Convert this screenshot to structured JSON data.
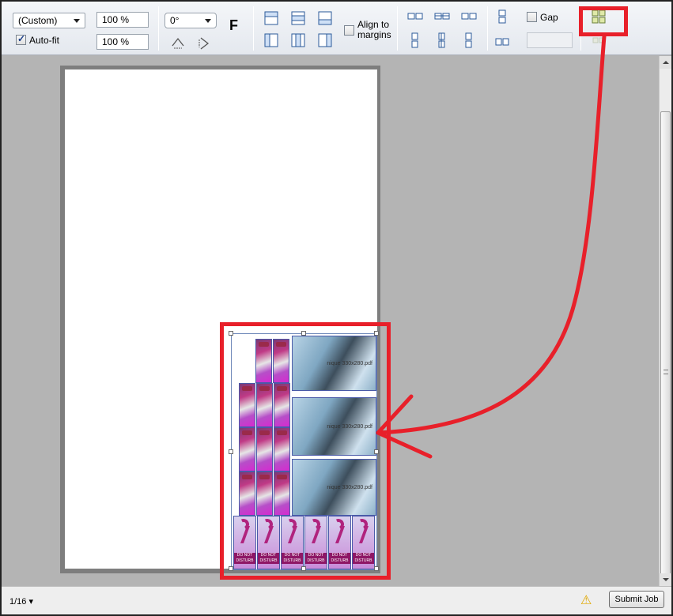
{
  "toolbar": {
    "paper_size": "(Custom)",
    "scale_x": "100 %",
    "scale_y": "100 %",
    "autofit_label": "Auto-fit",
    "autofit_checked": true,
    "rotation": "0°",
    "flip_label": "F",
    "align_margins_label_1": "Align to",
    "align_margins_label_2": "margins",
    "gap_label": "Gap",
    "gap_value": ""
  },
  "preview": {
    "photo_caption": "nique 330x280.pdf",
    "hanger_text": "DO NOT DISTURB"
  },
  "statusbar": {
    "page_indicator": "1/16",
    "submit_label": "Submit Job"
  },
  "colors": {
    "annotation_red": "#e8202a",
    "workspace_gray": "#b4b4b4"
  }
}
